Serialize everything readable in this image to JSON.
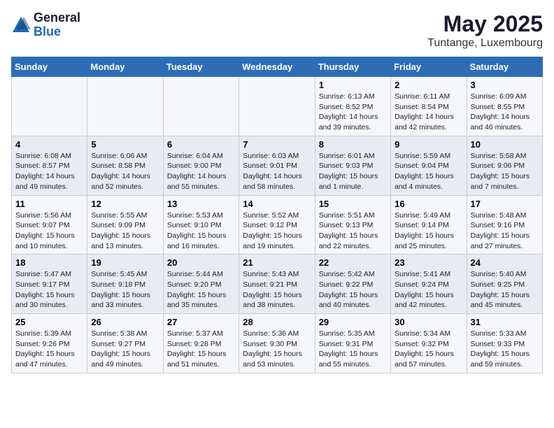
{
  "logo": {
    "general": "General",
    "blue": "Blue"
  },
  "title": "May 2025",
  "location": "Tuntange, Luxembourg",
  "days_of_week": [
    "Sunday",
    "Monday",
    "Tuesday",
    "Wednesday",
    "Thursday",
    "Friday",
    "Saturday"
  ],
  "weeks": [
    [
      {
        "day": "",
        "info": ""
      },
      {
        "day": "",
        "info": ""
      },
      {
        "day": "",
        "info": ""
      },
      {
        "day": "",
        "info": ""
      },
      {
        "day": "1",
        "info": "Sunrise: 6:13 AM\nSunset: 8:52 PM\nDaylight: 14 hours\nand 39 minutes."
      },
      {
        "day": "2",
        "info": "Sunrise: 6:11 AM\nSunset: 8:54 PM\nDaylight: 14 hours\nand 42 minutes."
      },
      {
        "day": "3",
        "info": "Sunrise: 6:09 AM\nSunset: 8:55 PM\nDaylight: 14 hours\nand 46 minutes."
      }
    ],
    [
      {
        "day": "4",
        "info": "Sunrise: 6:08 AM\nSunset: 8:57 PM\nDaylight: 14 hours\nand 49 minutes."
      },
      {
        "day": "5",
        "info": "Sunrise: 6:06 AM\nSunset: 8:58 PM\nDaylight: 14 hours\nand 52 minutes."
      },
      {
        "day": "6",
        "info": "Sunrise: 6:04 AM\nSunset: 9:00 PM\nDaylight: 14 hours\nand 55 minutes."
      },
      {
        "day": "7",
        "info": "Sunrise: 6:03 AM\nSunset: 9:01 PM\nDaylight: 14 hours\nand 58 minutes."
      },
      {
        "day": "8",
        "info": "Sunrise: 6:01 AM\nSunset: 9:03 PM\nDaylight: 15 hours\nand 1 minute."
      },
      {
        "day": "9",
        "info": "Sunrise: 5:59 AM\nSunset: 9:04 PM\nDaylight: 15 hours\nand 4 minutes."
      },
      {
        "day": "10",
        "info": "Sunrise: 5:58 AM\nSunset: 9:06 PM\nDaylight: 15 hours\nand 7 minutes."
      }
    ],
    [
      {
        "day": "11",
        "info": "Sunrise: 5:56 AM\nSunset: 9:07 PM\nDaylight: 15 hours\nand 10 minutes."
      },
      {
        "day": "12",
        "info": "Sunrise: 5:55 AM\nSunset: 9:09 PM\nDaylight: 15 hours\nand 13 minutes."
      },
      {
        "day": "13",
        "info": "Sunrise: 5:53 AM\nSunset: 9:10 PM\nDaylight: 15 hours\nand 16 minutes."
      },
      {
        "day": "14",
        "info": "Sunrise: 5:52 AM\nSunset: 9:12 PM\nDaylight: 15 hours\nand 19 minutes."
      },
      {
        "day": "15",
        "info": "Sunrise: 5:51 AM\nSunset: 9:13 PM\nDaylight: 15 hours\nand 22 minutes."
      },
      {
        "day": "16",
        "info": "Sunrise: 5:49 AM\nSunset: 9:14 PM\nDaylight: 15 hours\nand 25 minutes."
      },
      {
        "day": "17",
        "info": "Sunrise: 5:48 AM\nSunset: 9:16 PM\nDaylight: 15 hours\nand 27 minutes."
      }
    ],
    [
      {
        "day": "18",
        "info": "Sunrise: 5:47 AM\nSunset: 9:17 PM\nDaylight: 15 hours\nand 30 minutes."
      },
      {
        "day": "19",
        "info": "Sunrise: 5:45 AM\nSunset: 9:18 PM\nDaylight: 15 hours\nand 33 minutes."
      },
      {
        "day": "20",
        "info": "Sunrise: 5:44 AM\nSunset: 9:20 PM\nDaylight: 15 hours\nand 35 minutes."
      },
      {
        "day": "21",
        "info": "Sunrise: 5:43 AM\nSunset: 9:21 PM\nDaylight: 15 hours\nand 38 minutes."
      },
      {
        "day": "22",
        "info": "Sunrise: 5:42 AM\nSunset: 9:22 PM\nDaylight: 15 hours\nand 40 minutes."
      },
      {
        "day": "23",
        "info": "Sunrise: 5:41 AM\nSunset: 9:24 PM\nDaylight: 15 hours\nand 42 minutes."
      },
      {
        "day": "24",
        "info": "Sunrise: 5:40 AM\nSunset: 9:25 PM\nDaylight: 15 hours\nand 45 minutes."
      }
    ],
    [
      {
        "day": "25",
        "info": "Sunrise: 5:39 AM\nSunset: 9:26 PM\nDaylight: 15 hours\nand 47 minutes."
      },
      {
        "day": "26",
        "info": "Sunrise: 5:38 AM\nSunset: 9:27 PM\nDaylight: 15 hours\nand 49 minutes."
      },
      {
        "day": "27",
        "info": "Sunrise: 5:37 AM\nSunset: 9:28 PM\nDaylight: 15 hours\nand 51 minutes."
      },
      {
        "day": "28",
        "info": "Sunrise: 5:36 AM\nSunset: 9:30 PM\nDaylight: 15 hours\nand 53 minutes."
      },
      {
        "day": "29",
        "info": "Sunrise: 5:35 AM\nSunset: 9:31 PM\nDaylight: 15 hours\nand 55 minutes."
      },
      {
        "day": "30",
        "info": "Sunrise: 5:34 AM\nSunset: 9:32 PM\nDaylight: 15 hours\nand 57 minutes."
      },
      {
        "day": "31",
        "info": "Sunrise: 5:33 AM\nSunset: 9:33 PM\nDaylight: 15 hours\nand 59 minutes."
      }
    ]
  ]
}
